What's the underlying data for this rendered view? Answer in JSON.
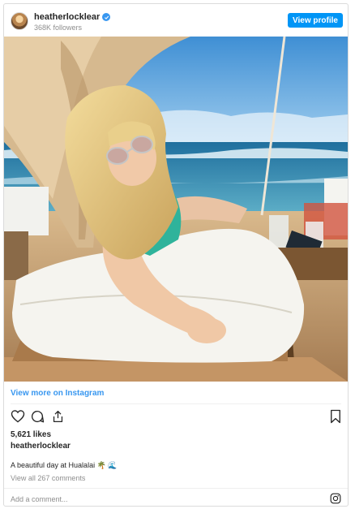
{
  "header": {
    "username": "heatherlocklear",
    "followers": "368K followers",
    "view_profile_label": "View profile"
  },
  "post": {
    "view_more_label": "View more on Instagram",
    "likes": "5,621 likes",
    "owner": "heatherlocklear",
    "caption": "A beautiful day at Hualalai 🌴 🌊",
    "comments_link": "View all 267 comments",
    "comment_placeholder": "Add a comment..."
  },
  "icons": {
    "like": "heart-icon",
    "comment": "comment-icon",
    "share": "share-icon",
    "save": "bookmark-icon",
    "logo": "instagram-icon",
    "verified": "verified-badge-icon"
  },
  "colors": {
    "accent": "#0095f6",
    "link": "#3897f0",
    "muted": "#8e8e8e",
    "text": "#262626"
  }
}
